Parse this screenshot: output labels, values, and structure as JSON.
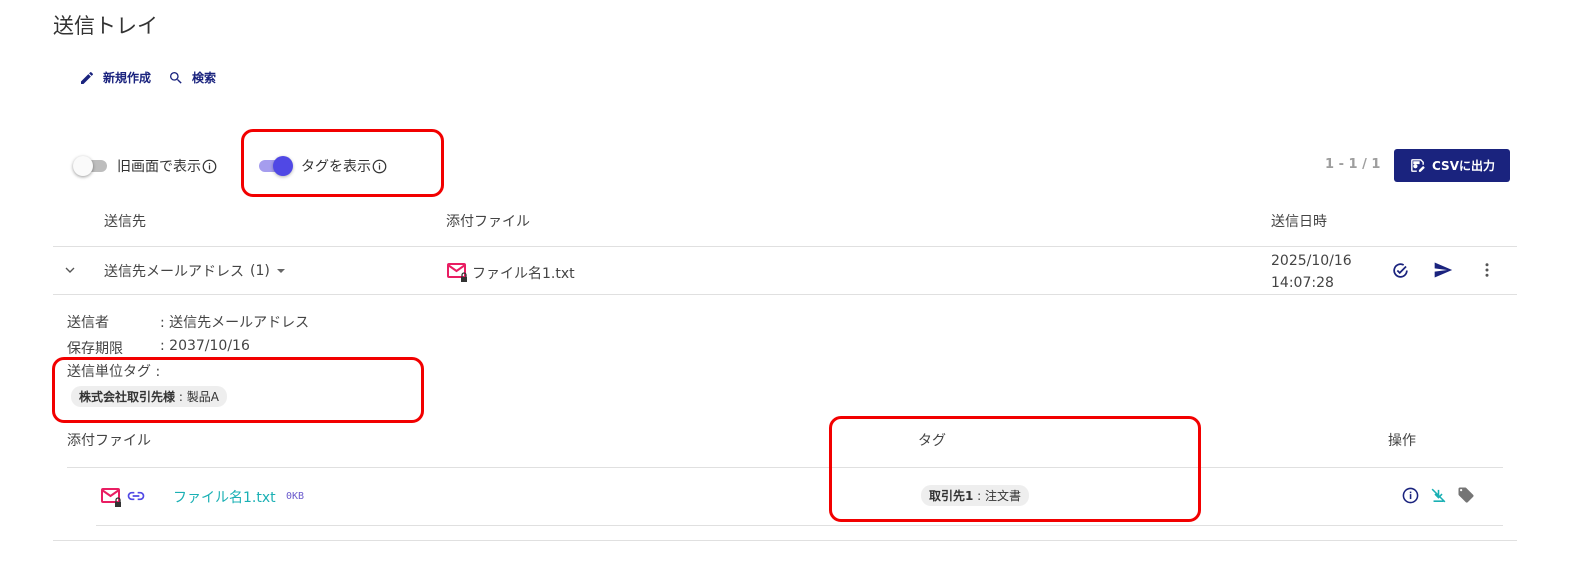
{
  "page": {
    "title": "送信トレイ"
  },
  "toolbar": {
    "new_label": "新規作成",
    "search_label": "検索"
  },
  "toggles": {
    "old_screen": {
      "label": "旧画面で表示",
      "on": false
    },
    "show_tags": {
      "label": "タグを表示",
      "on": true
    }
  },
  "pagination": "1 - 1 / 1",
  "csv_button": "CSVに出力",
  "table": {
    "headers": {
      "recipient": "送信先",
      "attachment": "添付ファイル",
      "sent_at": "送信日時"
    },
    "row": {
      "recipient": "送信先メールアドレス",
      "recipient_count": "(1)",
      "attachment": "ファイル名1.txt",
      "date": "2025/10/16",
      "time": "14:07:28"
    }
  },
  "detail": {
    "sender_label": "送信者",
    "sender_value": ": 送信先メールアドレス",
    "retention_label": "保存期限",
    "retention_value": ": 2037/10/16",
    "unit_tag_label": "送信単位タグ :",
    "unit_tag": {
      "key": "株式会社取引先様",
      "value": " : 製品A"
    },
    "files_table": {
      "headers": {
        "file": "添付ファイル",
        "tag": "タグ",
        "action": "操作"
      },
      "row": {
        "file_name": "ファイル名1.txt",
        "size": "0KB",
        "tag": {
          "key": "取引先1",
          "value": " : 注文書"
        }
      }
    }
  },
  "colors": {
    "primary": "#1a237e",
    "toggle_on": "#5048e5",
    "highlight": "#f20000",
    "link": "#1ab0b4",
    "mail_icon": "#e91e63"
  }
}
